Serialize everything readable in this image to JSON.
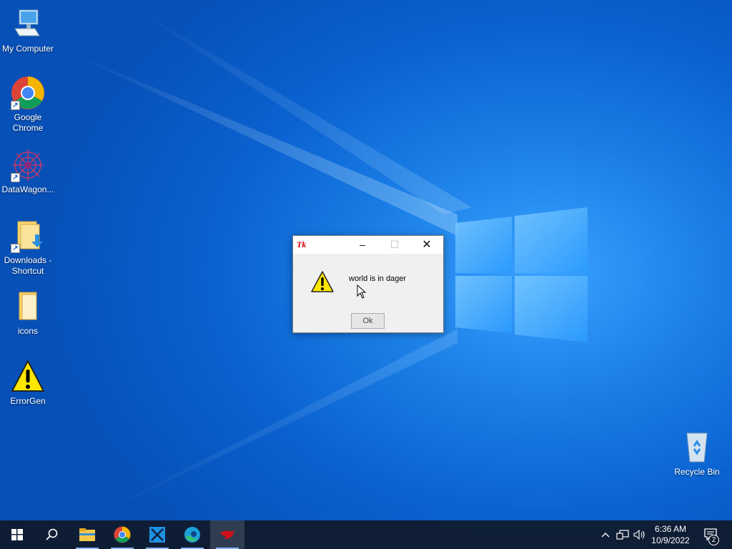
{
  "desktop": {
    "icons": [
      {
        "label": "My Computer",
        "icon": "computer-icon"
      },
      {
        "label": "Google Chrome",
        "icon": "chrome-icon"
      },
      {
        "label": "DataWagon...",
        "icon": "datawagon-icon"
      },
      {
        "label": "Downloads - Shortcut",
        "icon": "downloads-folder-icon"
      },
      {
        "label": "icons",
        "icon": "folder-icon"
      },
      {
        "label": "ErrorGen",
        "icon": "warning-icon"
      },
      {
        "label": "Recycle Bin",
        "icon": "recycle-bin-icon"
      }
    ]
  },
  "dialog": {
    "app_logo": "Tk",
    "message": "world is in dager",
    "ok_label": "Ok",
    "icon": "warning-icon"
  },
  "taskbar": {
    "items": [
      "start-icon",
      "search-icon",
      "file-explorer-icon",
      "chrome-icon",
      "snipping-tool-icon",
      "edge-icon",
      "tk-app-icon"
    ],
    "tray": {
      "time": "6:36 AM",
      "date": "10/9/2022",
      "notification_count": "2"
    }
  },
  "colors": {
    "accent": "#0a62d0",
    "taskbar": "#101a2a",
    "warning_yellow": "#ffe600"
  }
}
